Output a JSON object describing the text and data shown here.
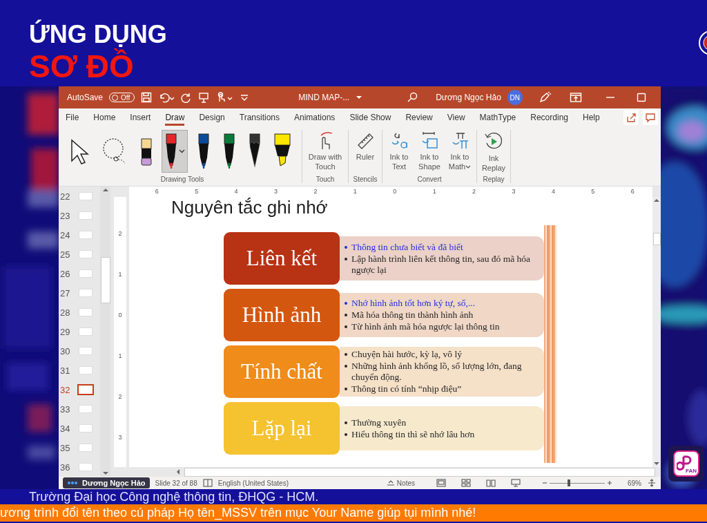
{
  "background": {
    "heading": "ỨNG DỤNG",
    "title_partial": "SƠ ĐỒ",
    "caption": "Trường Đại học Công nghệ thông tin, ĐHQG - HCM.",
    "banner": "ương trình đổi tên theo cú pháp Họ tên_MSSV trên mục Your Name giúp tụi mình nhé!",
    "logo_text": "FAN"
  },
  "window": {
    "autosave": {
      "label": "AutoSave",
      "toggle": "Off",
      "on": false
    },
    "title": "MIND MAP-...",
    "user": "Dương Ngọc Hảo",
    "avatar": "DN"
  },
  "tabs": [
    {
      "label": "File",
      "selected": false
    },
    {
      "label": "Home",
      "selected": false
    },
    {
      "label": "Insert",
      "selected": false
    },
    {
      "label": "Draw",
      "selected": true
    },
    {
      "label": "Design",
      "selected": false
    },
    {
      "label": "Transitions",
      "selected": false
    },
    {
      "label": "Animations",
      "selected": false
    },
    {
      "label": "Slide Show",
      "selected": false
    },
    {
      "label": "Review",
      "selected": false
    },
    {
      "label": "View",
      "selected": false
    },
    {
      "label": "MathType",
      "selected": false
    },
    {
      "label": "Recording",
      "selected": false
    },
    {
      "label": "Help",
      "selected": false
    }
  ],
  "ribbon": {
    "groups": [
      {
        "kind": "tools",
        "label": "Drawing Tools",
        "tools": [
          {
            "kind": "select",
            "selected": false
          },
          {
            "kind": "lasso",
            "selected": false
          },
          {
            "kind": "eraser",
            "selected": false
          },
          {
            "kind": "pen",
            "color": "#e8262a",
            "selected": true
          },
          {
            "kind": "pen",
            "color": "#0a4a9a",
            "selected": false
          },
          {
            "kind": "pen",
            "color": "#0a7a3a",
            "selected": false
          },
          {
            "kind": "pencil",
            "color": "#333333",
            "selected": false
          },
          {
            "kind": "highlighter",
            "color": "#ffe600",
            "selected": false
          }
        ]
      },
      {
        "kind": "buttons",
        "label": "Touch",
        "buttons": [
          {
            "kind": "touch",
            "label": "Draw with Touch"
          }
        ]
      },
      {
        "kind": "buttons",
        "label": "Stencils",
        "buttons": [
          {
            "kind": "ruler",
            "label": "Ruler"
          }
        ]
      },
      {
        "kind": "buttons",
        "label": "Convert",
        "buttons": [
          {
            "kind": "ink-text",
            "label": "Ink to Text"
          },
          {
            "kind": "ink-shape",
            "label": "Ink to Shape"
          },
          {
            "kind": "ink-math",
            "label": "Ink to Math",
            "dropdown": true
          }
        ]
      },
      {
        "kind": "buttons",
        "label": "Replay",
        "buttons": [
          {
            "kind": "replay",
            "label": "Ink Replay"
          }
        ]
      }
    ]
  },
  "rulers": {
    "horizontal": [
      "6",
      "5",
      "4",
      "3",
      "2",
      "1",
      "0",
      "1",
      "2",
      "3",
      "4",
      "5",
      "6"
    ],
    "vertical": [
      "2",
      "1",
      "0",
      "1",
      "2",
      "3"
    ]
  },
  "thumbnails": [
    {
      "number": "22",
      "selected": false
    },
    {
      "number": "23",
      "selected": false
    },
    {
      "number": "24",
      "selected": false
    },
    {
      "number": "25",
      "selected": false
    },
    {
      "number": "26",
      "selected": false
    },
    {
      "number": "27",
      "selected": false
    },
    {
      "number": "28",
      "selected": false
    },
    {
      "number": "29",
      "selected": false
    },
    {
      "number": "30",
      "selected": false
    },
    {
      "number": "31",
      "selected": false
    },
    {
      "number": "32",
      "selected": true
    },
    {
      "number": "33",
      "selected": false
    },
    {
      "number": "34",
      "selected": false
    },
    {
      "number": "35",
      "selected": false
    },
    {
      "number": "36",
      "selected": false
    }
  ],
  "slide": {
    "title": "Nguyên tắc ghi nhớ",
    "rows": [
      {
        "label": "Liên kết",
        "color": "#b83214",
        "bullets": [
          {
            "text": "Thông tin chưa biết và đã biết",
            "color": "#1f2fe0"
          },
          {
            "text": "Lập hành trình liên kết thông tin, sau đó mã hóa ngược lại",
            "color": "#262626"
          }
        ]
      },
      {
        "label": "Hình ảnh",
        "color": "#d4570f",
        "bullets": [
          {
            "text": "Nhớ hình ảnh tốt hơn ký tự, số,...",
            "color": "#1f2fe0"
          },
          {
            "text": "Mã hóa thông tin thành hình ảnh",
            "color": "#262626"
          },
          {
            "text": "Từ hình ảnh mã hóa ngược lại thông tin",
            "color": "#262626"
          }
        ]
      },
      {
        "label": "Tính chất",
        "color": "#ef8c1a",
        "bullets": [
          {
            "text": "Chuyện hài hước, kỳ lạ, vô lý",
            "color": "#262626"
          },
          {
            "text": "Những hình ảnh khổng lồ, số lượng lớn, đang chuyển động.",
            "color": "#262626"
          },
          {
            "text": "Thông tin có tính “nhịp điệu”",
            "color": "#262626"
          }
        ]
      },
      {
        "label": "Lặp lại",
        "color": "#f5c230",
        "bullets": [
          {
            "text": "Thường xuyên",
            "color": "#262626"
          },
          {
            "text": "Hiểu thông tin thì sẽ nhớ lâu hơn",
            "color": "#262626"
          }
        ]
      }
    ]
  },
  "status_bar": {
    "slide": "Slide 32 of 88",
    "language": "English (United States)",
    "notes": "Notes",
    "zoom": {
      "level": 0.35
    },
    "zoom_label": "69%"
  },
  "presenter": {
    "name": "Dương Ngọc Hảo"
  }
}
